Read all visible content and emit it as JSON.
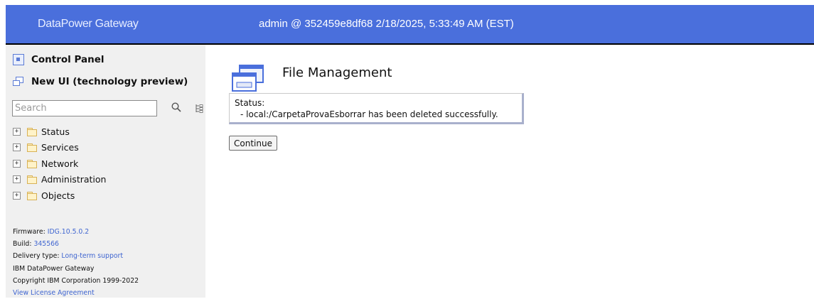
{
  "header": {
    "brand": "DataPower Gateway",
    "session": "admin @ 352459e8df68 2/18/2025, 5:33:49 AM (EST)",
    "bg_color": "#4a6fdc"
  },
  "sidebar": {
    "control_panel": "Control Panel",
    "new_ui": "New UI (technology preview)",
    "search": {
      "placeholder": "Search",
      "value": ""
    },
    "tree": [
      {
        "label": "Status"
      },
      {
        "label": "Services"
      },
      {
        "label": "Network"
      },
      {
        "label": "Administration"
      },
      {
        "label": "Objects"
      }
    ],
    "footer": {
      "firmware_label": "Firmware:",
      "firmware_value": "IDG.10.5.0.2",
      "build_label": "Build:",
      "build_value": "345566",
      "delivery_label": "Delivery type:",
      "delivery_value": "Long-term support",
      "product": "IBM DataPower Gateway",
      "copyright": "Copyright IBM Corporation 1999-2022",
      "license_link": "View License Agreement"
    }
  },
  "main": {
    "title": "File Management",
    "status_label": "Status:",
    "status_message": "- local:/CarpetaProvaEsborrar has been deleted successfully.",
    "continue_label": "Continue"
  }
}
